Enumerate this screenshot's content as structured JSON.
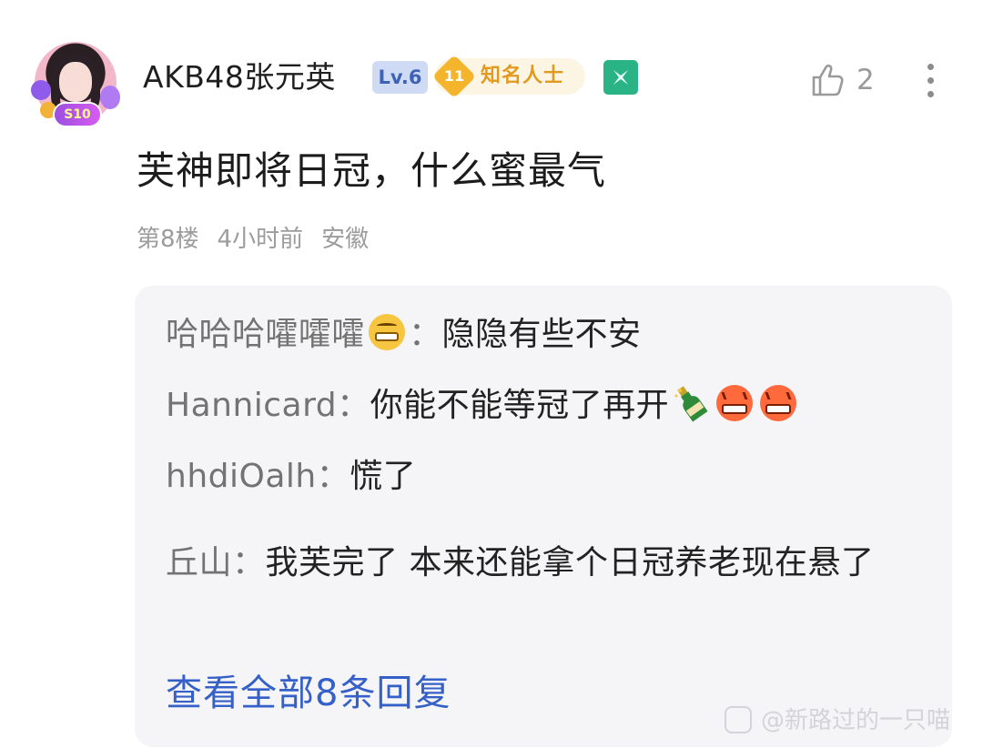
{
  "comment": {
    "user": {
      "name": "AKB48张元英",
      "level_badge": "Lv.6",
      "fan_level": "11",
      "fan_title": "知名人士",
      "avatar_tag": "S10",
      "avatar_icon": "avatar-image",
      "extra_badge_icon": "green-special-badge-icon"
    },
    "like_count": "2",
    "text": "芙神即将日冠，什么蜜最气",
    "meta": {
      "floor": "第8楼",
      "time": "4小时前",
      "location": "安徽"
    }
  },
  "replies": [
    {
      "author": "哈哈哈嚯嚯嚯",
      "author_emoji": "grin-emoji",
      "text": "隐隐有些不安"
    },
    {
      "author": "Hannicard",
      "text": "你能不能等冠了再开",
      "emojis": [
        "champagne-emoji",
        "angry-emoji",
        "angry-emoji"
      ]
    },
    {
      "author": "hhdiOalh",
      "text": "慌了"
    },
    {
      "author": "丘山",
      "text": "我芙完了 本来还能拿个日冠养老现在悬了"
    }
  ],
  "view_all": "查看全部8条回复",
  "watermark": "@新路过的一只喵",
  "colors": {
    "link_blue": "#3560c8",
    "meta_gray": "#9c9c9c",
    "reply_bg": "#f5f5f7",
    "fan_gold": "#e19a1f",
    "level_blue": "#3e63b5"
  }
}
